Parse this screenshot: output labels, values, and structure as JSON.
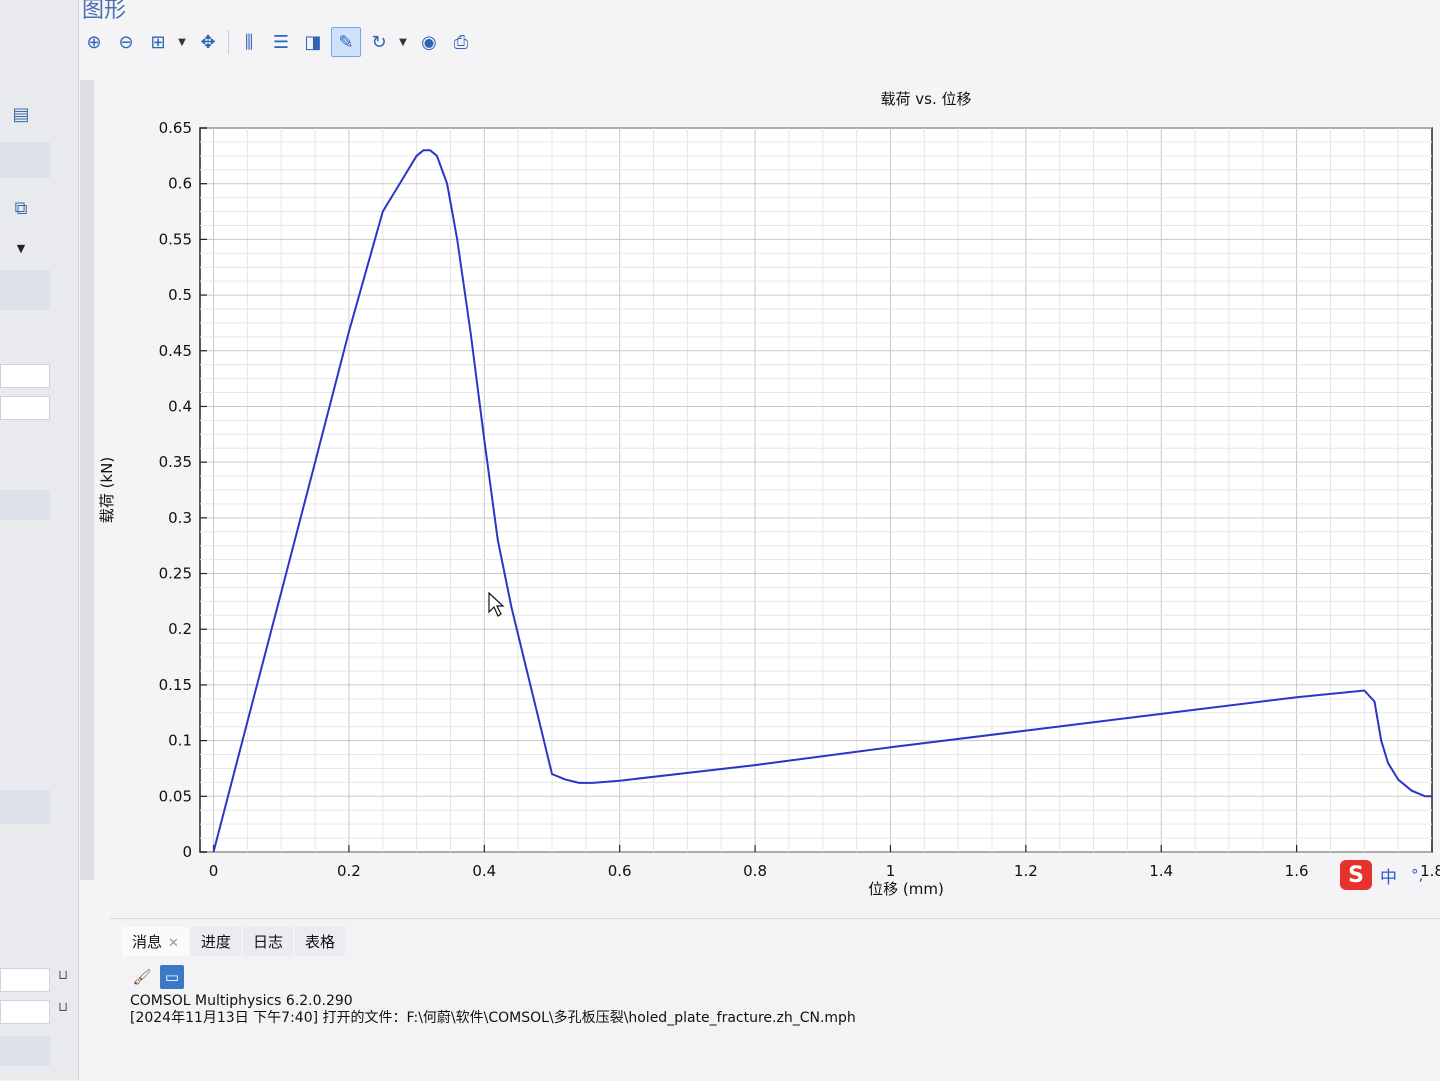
{
  "panel_title": "图形",
  "toolbar": {
    "icons": [
      "zoom-in-icon",
      "zoom-out-icon",
      "zoom-box-icon",
      "zoom-extents-icon",
      "x-grid-icon",
      "y-grid-icon",
      "legend-icon",
      "annotation-icon",
      "rotate-icon",
      "screenshot-icon",
      "print-icon"
    ]
  },
  "chart_data": {
    "type": "line",
    "title": "载荷 vs. 位移",
    "xlabel": "位移 (mm)",
    "ylabel": "载荷 (kN)",
    "xlim": [
      -0.02,
      1.8
    ],
    "ylim": [
      0,
      0.65
    ],
    "grid": true,
    "x_ticks": [
      "0",
      "0.2",
      "0.4",
      "0.6",
      "0.8",
      "1",
      "1.2",
      "1.4",
      "1.6",
      "1.8"
    ],
    "y_ticks": [
      "0",
      "0.05",
      "0.1",
      "0.15",
      "0.2",
      "0.25",
      "0.3",
      "0.35",
      "0.4",
      "0.45",
      "0.5",
      "0.55",
      "0.6",
      "0.65"
    ],
    "series": [
      {
        "color": "#2b35c7",
        "x": [
          0.0,
          0.05,
          0.1,
          0.15,
          0.2,
          0.25,
          0.28,
          0.3,
          0.31,
          0.32,
          0.33,
          0.345,
          0.36,
          0.38,
          0.4,
          0.42,
          0.44,
          0.46,
          0.48,
          0.5,
          0.52,
          0.54,
          0.56,
          0.6,
          0.8,
          1.0,
          1.2,
          1.4,
          1.6,
          1.7,
          1.715,
          1.725,
          1.735,
          1.75,
          1.77,
          1.79,
          1.8
        ],
        "y": [
          0.0,
          0.117,
          0.233,
          0.35,
          0.467,
          0.575,
          0.605,
          0.625,
          0.63,
          0.63,
          0.625,
          0.6,
          0.55,
          0.465,
          0.37,
          0.28,
          0.22,
          0.17,
          0.12,
          0.07,
          0.065,
          0.062,
          0.062,
          0.064,
          0.078,
          0.094,
          0.109,
          0.124,
          0.139,
          0.145,
          0.135,
          0.1,
          0.08,
          0.065,
          0.055,
          0.05,
          0.05
        ]
      }
    ]
  },
  "bottom": {
    "tabs": [
      "消息",
      "进度",
      "日志",
      "表格"
    ],
    "messages": [
      "COMSOL Multiphysics 6.2.0.290",
      "[2024年11月13日 下午7:40] 打开的文件：F:\\何蔚\\软件\\COMSOL\\多孔板压裂\\holed_plate_fracture.zh_CN.mph"
    ]
  },
  "ime": {
    "logo": "S",
    "mode": "中",
    "punct": "°,"
  }
}
